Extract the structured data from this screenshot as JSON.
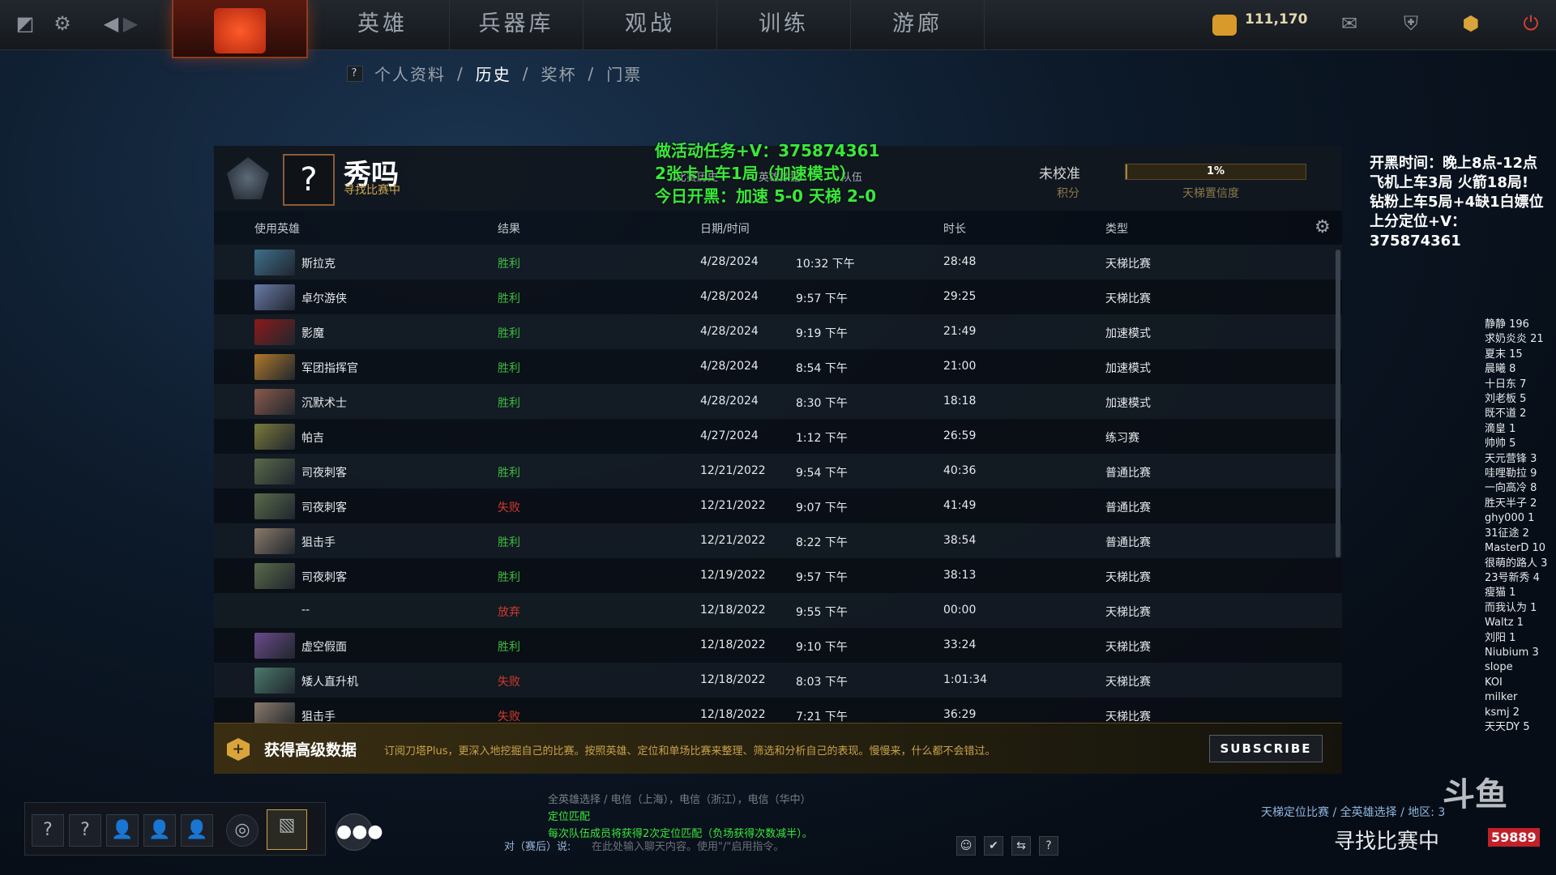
{
  "topbar": {
    "nav": [
      "英雄",
      "兵器库",
      "观战",
      "训练",
      "游廊"
    ],
    "currency": "111,170"
  },
  "subnav": {
    "help": "?",
    "items": [
      "个人资料",
      "历史",
      "奖杯",
      "门票"
    ],
    "separator": "/"
  },
  "profile": {
    "name": "秀吗",
    "status": "寻找比赛中",
    "avatar": "?",
    "mini_tabs": [
      "比赛历史",
      "英雄数据",
      "队伍"
    ],
    "uncalibrated": "未校准",
    "score_label": "积分",
    "confidence_value": "1%",
    "confidence_fraction": 0.01,
    "confidence_label": "天梯置信度"
  },
  "promo": {
    "line1": "做活动任务+V：375874361",
    "line2": "2张卡上车1局（加速模式）",
    "line3": "今日开黑：加速 5-0  天梯 2-0"
  },
  "table": {
    "headers": {
      "hero": "使用英雄",
      "result": "结果",
      "datetime": "日期/时间",
      "duration": "时长",
      "type": "类型"
    },
    "rows": [
      {
        "hero": "斯拉克",
        "result": "胜利",
        "date": "4/28/2024",
        "time": "10:32 下午",
        "duration": "28:48",
        "type": "天梯比赛",
        "result_color": "#3dbb3d",
        "img": "#3f6f8c"
      },
      {
        "hero": "卓尔游侠",
        "result": "胜利",
        "date": "4/28/2024",
        "time": "9:57 下午",
        "duration": "29:25",
        "type": "天梯比赛",
        "result_color": "#3dbb3d",
        "img": "#6a7aa8"
      },
      {
        "hero": "影魔",
        "result": "胜利",
        "date": "4/28/2024",
        "time": "9:19 下午",
        "duration": "21:49",
        "type": "加速模式",
        "result_color": "#3dbb3d",
        "img": "#8a1a1a"
      },
      {
        "hero": "军团指挥官",
        "result": "胜利",
        "date": "4/28/2024",
        "time": "8:54 下午",
        "duration": "21:00",
        "type": "加速模式",
        "result_color": "#3dbb3d",
        "img": "#b0782a"
      },
      {
        "hero": "沉默术士",
        "result": "胜利",
        "date": "4/28/2024",
        "time": "8:30 下午",
        "duration": "18:18",
        "type": "加速模式",
        "result_color": "#3dbb3d",
        "img": "#8a5a4a"
      },
      {
        "hero": "帕吉",
        "result": "",
        "date": "4/27/2024",
        "time": "1:12 下午",
        "duration": "26:59",
        "type": "练习赛",
        "result_color": "#3dbb3d",
        "img": "#7a7a3a"
      },
      {
        "hero": "司夜刺客",
        "result": "胜利",
        "date": "12/21/2022",
        "time": "9:54 下午",
        "duration": "40:36",
        "type": "普通比赛",
        "result_color": "#3dbb3d",
        "img": "#5a6a4a"
      },
      {
        "hero": "司夜刺客",
        "result": "失败",
        "date": "12/21/2022",
        "time": "9:07 下午",
        "duration": "41:49",
        "type": "普通比赛",
        "result_color": "#d43a2a",
        "img": "#5a6a4a"
      },
      {
        "hero": "狙击手",
        "result": "胜利",
        "date": "12/21/2022",
        "time": "8:22 下午",
        "duration": "38:54",
        "type": "普通比赛",
        "result_color": "#3dbb3d",
        "img": "#8a7a6a"
      },
      {
        "hero": "司夜刺客",
        "result": "胜利",
        "date": "12/19/2022",
        "time": "9:57 下午",
        "duration": "38:13",
        "type": "天梯比赛",
        "result_color": "#3dbb3d",
        "img": "#5a6a4a"
      },
      {
        "hero": "--",
        "result": "放弃",
        "date": "12/18/2022",
        "time": "9:55 下午",
        "duration": "00:00",
        "type": "天梯比赛",
        "result_color": "#d43a2a",
        "img": ""
      },
      {
        "hero": "虚空假面",
        "result": "胜利",
        "date": "12/18/2022",
        "time": "9:10 下午",
        "duration": "33:24",
        "type": "天梯比赛",
        "result_color": "#3dbb3d",
        "img": "#6a4a8a"
      },
      {
        "hero": "矮人直升机",
        "result": "失败",
        "date": "12/18/2022",
        "time": "8:03 下午",
        "duration": "1:01:34",
        "type": "天梯比赛",
        "result_color": "#d43a2a",
        "img": "#4a7a6a"
      },
      {
        "hero": "狙击手",
        "result": "失败",
        "date": "12/18/2022",
        "time": "7:21 下午",
        "duration": "36:29",
        "type": "天梯比赛",
        "result_color": "#d43a2a",
        "img": "#8a7a6a"
      }
    ]
  },
  "plus": {
    "title": "获得高级数据",
    "desc": "订阅刀塔Plus，更深入地挖掘自己的比赛。按照英雄、定位和单场比赛来整理、筛选和分析自己的表现。慢慢来，什么都不会错过。",
    "button": "SUBSCRIBE"
  },
  "right_notes": [
    "开黑时间：晚上8点-12点",
    "飞机上车3局  火箭18局!",
    "钻粉上车5局+4缺1白嫖位",
    "上分定位+V：375874361"
  ],
  "viewers": [
    "静静 196",
    "求奶炎炎 21",
    "夏末 15",
    "晨曦 8",
    "十日东 7",
    "刘老板 5",
    "既不道 2",
    "滴皇 1",
    "帅帅 5",
    "天元营锋 3",
    "哇哩勒拉 9",
    "一向高冷 8",
    "胜天半子 2",
    "ghy000 1",
    "31征途 2",
    "MasterD 10",
    "很萌的路人 3",
    "23号新秀 4",
    "瘦猫 1",
    "而我认为 1",
    "Waltz 1",
    "刘阳 1",
    "Niubium 3",
    "slope",
    "KOI",
    "milker",
    "ksmj 2",
    "天天DY 5"
  ],
  "chat": {
    "line1": "全英雄选择 / 电信（上海），电信（浙江），电信（华中）",
    "line2": "定位匹配",
    "line3": "每次队伍成员将获得2次定位匹配（负场获得次数减半）。",
    "prefix": "对（赛后）说:",
    "placeholder": "在此处输入聊天内容。使用\"/\"启用指令。"
  },
  "status": {
    "mode": "天梯定位比赛 / 全英雄选择 / 地区: 3",
    "finding": "寻找比赛中",
    "room": "59889",
    "watermark": "斗鱼"
  }
}
